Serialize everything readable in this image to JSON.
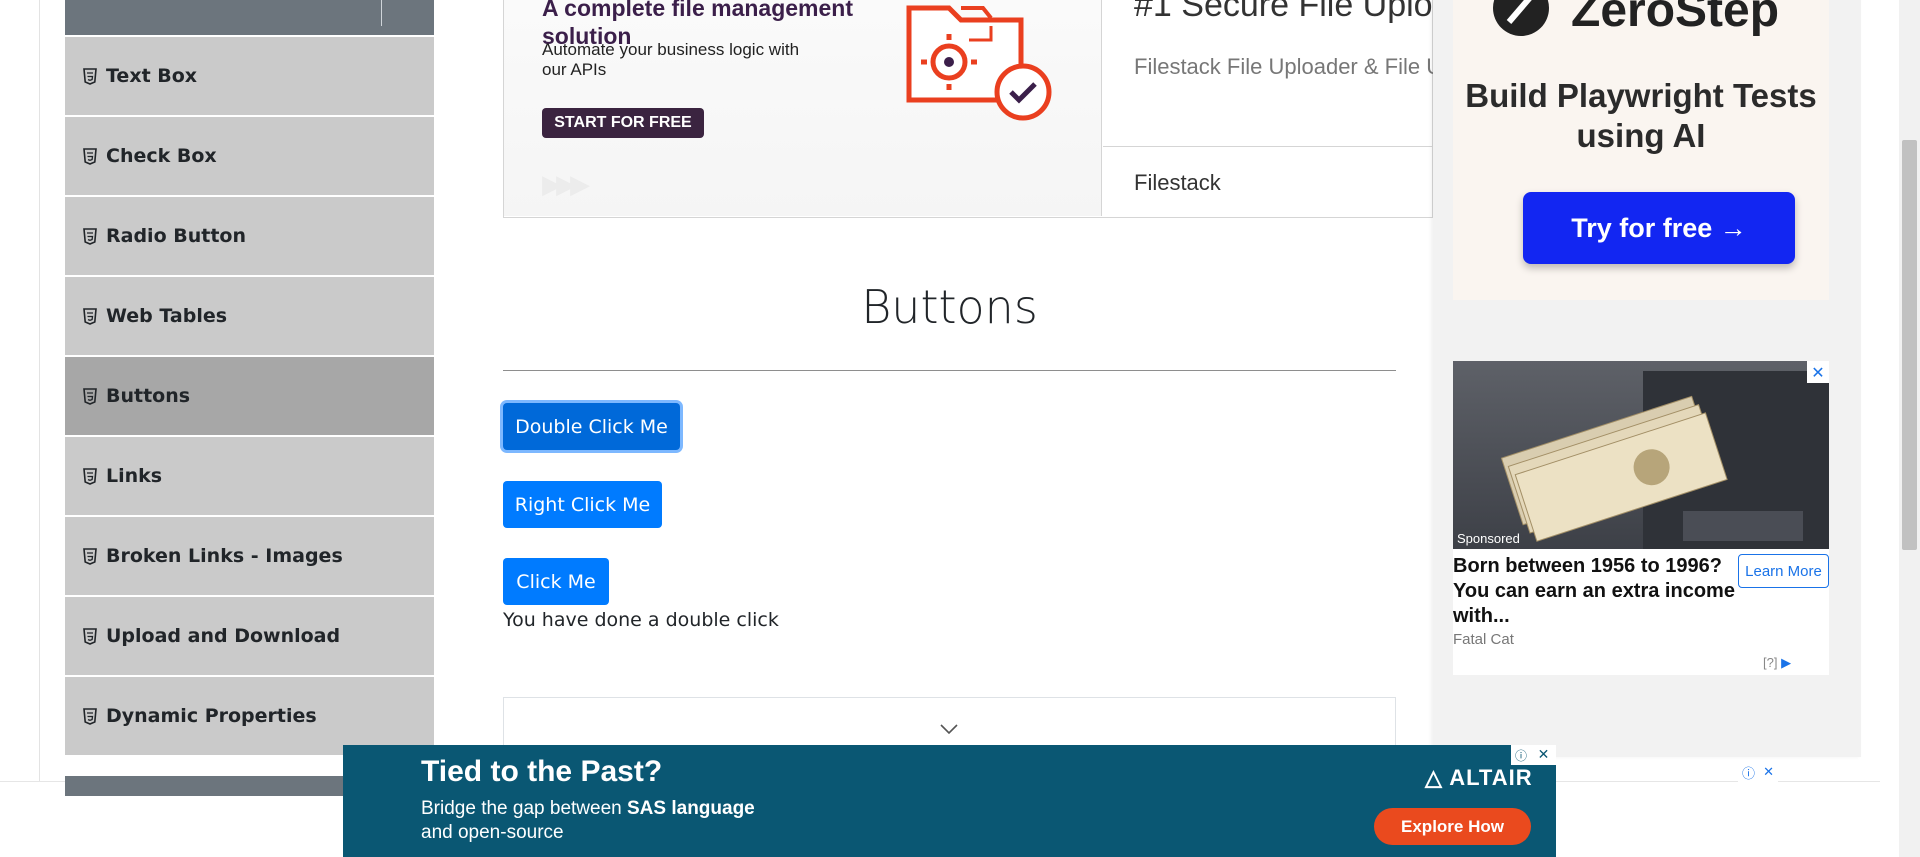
{
  "sidebar": {
    "items": [
      {
        "label": "Text Box"
      },
      {
        "label": "Check Box"
      },
      {
        "label": "Radio Button"
      },
      {
        "label": "Web Tables"
      },
      {
        "label": "Buttons",
        "active": true
      },
      {
        "label": "Links"
      },
      {
        "label": "Broken Links - Images"
      },
      {
        "label": "Upload and Download"
      },
      {
        "label": "Dynamic Properties"
      }
    ]
  },
  "top_ad": {
    "headline": "A complete file management solution",
    "subtext": "Automate your business logic with our APIs",
    "cta": "START FOR FREE",
    "right_title": "#1 Secure File Uplo",
    "right_subtitle": "Filestack File Uploader & File U",
    "brand": "Filestack"
  },
  "main": {
    "title": "Buttons",
    "buttons": {
      "double_click": "Double Click Me",
      "right_click": "Right Click Me",
      "click": "Click Me"
    },
    "message": "You have done a double click"
  },
  "right_ads": {
    "zerostep": {
      "brand": "ZeroStep",
      "title": "Build Playwright Tests using AI",
      "cta": "Try for free →"
    },
    "sponsored": {
      "tag": "Sponsored",
      "headline": "Born between 1956 to 1996? You can earn an extra income with...",
      "learn_more": "Learn More",
      "source": "Fatal Cat",
      "ad_info": "[?]"
    }
  },
  "bottom_ad": {
    "title": "Tied to the Past?",
    "sub_prefix": "Bridge the gap between ",
    "sub_bold": "SAS language",
    "sub_suffix": "and open-source",
    "brand": "ALTAIR",
    "cta": "Explore How"
  },
  "colors": {
    "primary_button": "#007bff",
    "sidebar_item": "#cacaca",
    "sidebar_active": "#a7a7a7",
    "bottom_ad_bg": "#0a5773",
    "zero_cta": "#1226f2"
  }
}
